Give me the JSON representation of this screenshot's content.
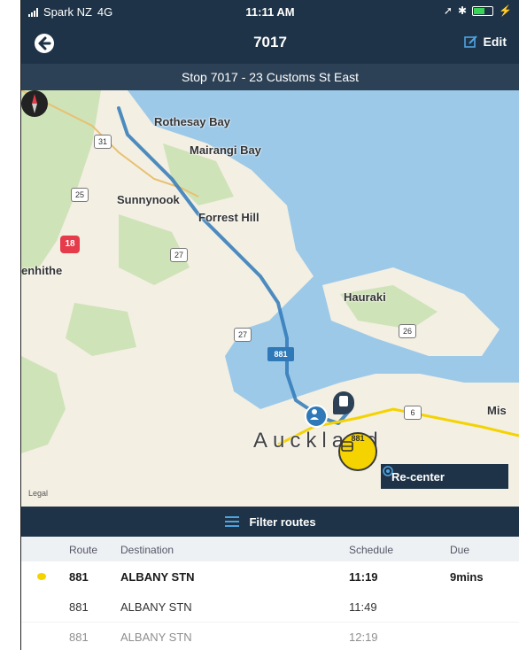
{
  "status_bar": {
    "carrier": "Spark NZ",
    "network": "4G",
    "time": "11:11 AM"
  },
  "header": {
    "title": "7017",
    "edit_label": "Edit"
  },
  "stop_title": "Stop 7017 - 23 Customs St East",
  "map": {
    "labels": [
      "Rothesay Bay",
      "Mairangi Bay",
      "Sunnynook",
      "Forrest Hill",
      "enhithe",
      "Hauraki",
      "Auckland",
      "Mis"
    ],
    "road_shields": [
      "31",
      "25",
      "27",
      "27",
      "26",
      "6"
    ],
    "highway_shield": "18",
    "route_badge": "881",
    "bus_marker_label": "881",
    "recenter_label": "Re-center",
    "legal_label": "Legal"
  },
  "filter_label": "Filter routes",
  "table": {
    "headers": [
      "Route",
      "Destination",
      "Schedule",
      "Due"
    ],
    "rows": [
      {
        "route": "881",
        "destination": "ALBANY STN",
        "schedule": "11:19",
        "due": "9mins"
      },
      {
        "route": "881",
        "destination": "ALBANY STN",
        "schedule": "11:49",
        "due": ""
      },
      {
        "route": "881",
        "destination": "ALBANY STN",
        "schedule": "12:19",
        "due": ""
      }
    ]
  },
  "colors": {
    "nav_dark": "#1e3347",
    "stop_bar": "#2d4156",
    "accent_blue": "#2f79b8",
    "bus_yellow": "#f4d300",
    "water": "#9dc9e8",
    "land": "#f3efe3",
    "park": "#cfe3b8"
  }
}
